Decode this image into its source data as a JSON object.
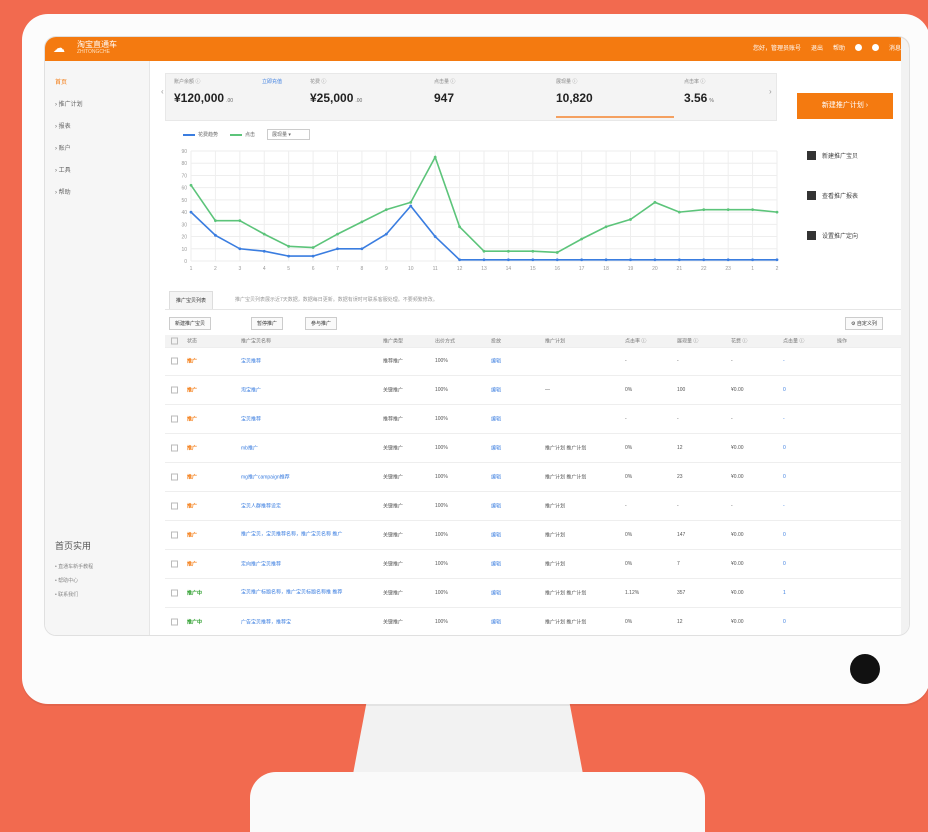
{
  "screen": {
    "brand": {
      "name": "淘宝直通车",
      "subtitle": "ZHITONGCHE"
    },
    "topbar_right": [
      "您好，管理员账号",
      "退出",
      "帮助",
      "·",
      "消息"
    ]
  },
  "sidebar": {
    "items": [
      {
        "label": "首页",
        "active": true
      },
      {
        "label": "› 推广计划",
        "active": false
      },
      {
        "label": "› 报表",
        "active": false
      },
      {
        "label": "› 账户",
        "active": false
      },
      {
        "label": "› 工具",
        "active": false
      },
      {
        "label": "› 帮助",
        "active": false
      }
    ],
    "section_title": "首页实用",
    "links": [
      "• 直通车新手教程",
      "• 帮助中心",
      "• 联系我们"
    ]
  },
  "stats": [
    {
      "label": "账户余额 ⓘ",
      "value": "¥120,000",
      "unit": ".00"
    },
    {
      "label": "花费 ⓘ",
      "value": "¥25,000",
      "unit": ".00"
    },
    {
      "label": "点击量 ⓘ",
      "value": "947",
      "unit": ""
    },
    {
      "label": "展现量 ⓘ",
      "value": "10,820",
      "unit": ""
    },
    {
      "label": "点击率 ⓘ",
      "value": "3.56",
      "unit": "%"
    }
  ],
  "stats_link": "立即充值",
  "cta": "新建推广计划 ›",
  "side_actions": [
    {
      "label": "新建推广宝贝",
      "icon": "person-icon"
    },
    {
      "label": "查看推广报表",
      "icon": "printer-icon"
    },
    {
      "label": "设置推广定向",
      "icon": "card-icon"
    }
  ],
  "legend": {
    "series1": "花费趋势",
    "series2": "点击",
    "select": "展现量 ▾"
  },
  "chart_data": {
    "type": "line",
    "x": [
      "1",
      "2",
      "3",
      "4",
      "5",
      "6",
      "7",
      "8",
      "9",
      "10",
      "11",
      "12",
      "13",
      "14",
      "15",
      "16",
      "17",
      "18",
      "19",
      "20",
      "21",
      "22",
      "23"
    ],
    "ylim": [
      0,
      90
    ],
    "y_ticks": [
      "0",
      "10",
      "20",
      "30",
      "40",
      "50",
      "60",
      "70",
      "80",
      "90"
    ],
    "series": [
      {
        "name": "",
        "color": "#5cc47a",
        "values": [
          62,
          33,
          33,
          22,
          12,
          11,
          22,
          32,
          42,
          48,
          85,
          28,
          8,
          8,
          8,
          7,
          18,
          28,
          34,
          48,
          40,
          42,
          42,
          42,
          40
        ]
      },
      {
        "name": "",
        "color": "#3a7de0",
        "values": [
          40,
          21,
          10,
          8,
          4,
          4,
          10,
          10,
          22,
          45,
          20,
          1,
          1,
          1,
          1,
          1,
          1,
          1,
          1,
          1,
          1,
          1,
          1,
          1,
          1
        ]
      }
    ]
  },
  "tab": "推广宝贝列表",
  "tab_note": "推广宝贝列表展示近7天数据，数据每日更新。数据有误时可联系客服处理。不要频繁修改。",
  "toolbar_buttons": [
    "新建推广宝贝",
    "暂停推广",
    "参与推广"
  ],
  "toolbar_right": "⚙ 自定义列",
  "table": {
    "headers": [
      "",
      "状态",
      "推广宝贝名称",
      "推广类型",
      "出价方式",
      "投放",
      "推广计划",
      "点击率 ⓘ",
      "展现量 ⓘ",
      "花费 ⓘ",
      "点击量 ⓘ",
      "操作"
    ],
    "rows": [
      {
        "status": "推广",
        "status_kind": "o",
        "name": "宝贝推荐",
        "name2": "",
        "type": "推荐推广",
        "pct": "100%",
        "link": "编辑",
        "plan": "",
        "ctr": "-",
        "imp": "-",
        "cost": "-",
        "clk": "-"
      },
      {
        "status": "推广",
        "status_kind": "o",
        "name": "淘宝推广",
        "name2": "",
        "type": "关键推广",
        "pct": "100%",
        "link": "编辑",
        "plan": "—",
        "ctr": "0%",
        "imp": "100",
        "cost": "¥0.00",
        "clk": "0"
      },
      {
        "status": "推广",
        "status_kind": "o",
        "name": "宝贝推荐",
        "name2": "",
        "type": "推荐推广",
        "pct": "100%",
        "link": "编辑",
        "plan": "",
        "ctr": "-",
        "imp": "-",
        "cost": "-",
        "clk": "-"
      },
      {
        "status": "推广",
        "status_kind": "o",
        "name": "mb推广",
        "name2": "",
        "type": "关键推广",
        "pct": "100%",
        "link": "编辑",
        "plan": "推广计划 推广计划",
        "ctr": "0%",
        "imp": "12",
        "cost": "¥0.00",
        "clk": "0"
      },
      {
        "status": "推广",
        "status_kind": "o",
        "name": "mg推广campaign推荐",
        "name2": "",
        "type": "关键推广",
        "pct": "100%",
        "link": "编辑",
        "plan": "推广计划 推广计划",
        "ctr": "0%",
        "imp": "23",
        "cost": "¥0.00",
        "clk": "0"
      },
      {
        "status": "推广",
        "status_kind": "o",
        "name": "宝贝人群推荐设定",
        "name2": "",
        "type": "关键推广",
        "pct": "100%",
        "link": "编辑",
        "plan": "推广计划",
        "ctr": "-",
        "imp": "-",
        "cost": "-",
        "clk": "-"
      },
      {
        "status": "推广",
        "status_kind": "o",
        "name": "推广宝贝，宝贝推荐名称，推广宝贝名称",
        "name2": "推广",
        "type": "关键推广",
        "pct": "100%",
        "link": "编辑",
        "plan": "推广计划",
        "ctr": "0%",
        "imp": "147",
        "cost": "¥0.00",
        "clk": "0"
      },
      {
        "status": "推广",
        "status_kind": "o",
        "name": "定向推广宝贝推荐",
        "name2": "",
        "type": "关键推广",
        "pct": "100%",
        "link": "编辑",
        "plan": "推广计划",
        "ctr": "0%",
        "imp": "7",
        "cost": "¥0.00",
        "clk": "0"
      },
      {
        "status": "推广中",
        "status_kind": "g",
        "name": "宝贝推广标题名称，推广宝贝标题名称推",
        "name2": "推荐",
        "type": "关键推广",
        "pct": "100%",
        "link": "编辑",
        "plan": "推广计划 推广计划",
        "ctr": "1.12%",
        "imp": "357",
        "cost": "¥0.00",
        "clk": "1"
      },
      {
        "status": "推广中",
        "status_kind": "g",
        "name": "广告宝贝推荐，推荐宝",
        "name2": "",
        "type": "关键推广",
        "pct": "100%",
        "link": "编辑",
        "plan": "推广计划 推广计划",
        "ctr": "0%",
        "imp": "12",
        "cost": "¥0.00",
        "clk": "0"
      }
    ]
  }
}
